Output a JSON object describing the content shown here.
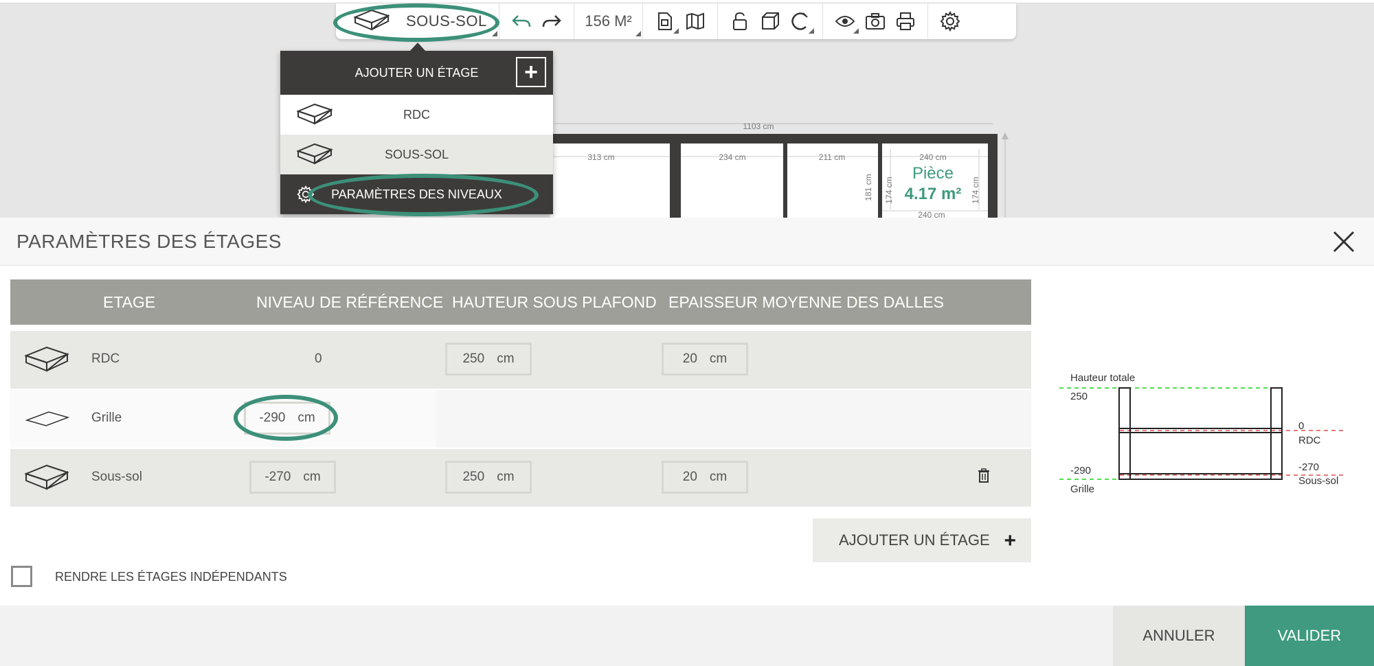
{
  "toolbar": {
    "current_floor": "SOUS-SOL",
    "area": "156 M²"
  },
  "floor_menu": {
    "add_label": "AJOUTER UN ÉTAGE",
    "add_icon": "plus-icon",
    "items": [
      {
        "label": "RDC"
      },
      {
        "label": "SOUS-SOL"
      }
    ],
    "settings_label": "PARAMÈTRES DES NIVEAUX"
  },
  "plan": {
    "total_width": "1103 cm",
    "dims": [
      "313 cm",
      "234 cm",
      "211 cm",
      "240 cm",
      "240 cm",
      "181 cm",
      "174 cm",
      "174 cm"
    ],
    "room_name": "Pièce",
    "room_area": "4.17 m²"
  },
  "modal": {
    "title": "PARAMÈTRES DES ÉTAGES",
    "columns": [
      "ETAGE",
      "NIVEAU DE RÉFÉRENCE",
      "HAUTEUR SOUS PLAFOND",
      "EPAISSEUR MOYENNE DES DALLES"
    ],
    "rows": [
      {
        "name": "RDC",
        "reference": "0",
        "height": "250",
        "height_unit": "cm",
        "slab": "20",
        "slab_unit": "cm"
      },
      {
        "name": "Grille",
        "reference": "-290",
        "reference_unit": "cm"
      },
      {
        "name": "Sous-sol",
        "reference": "-270",
        "reference_unit": "cm",
        "height": "250",
        "height_unit": "cm",
        "slab": "20",
        "slab_unit": "cm"
      }
    ],
    "add_floor": "AJOUTER UN ÉTAGE",
    "independent_label": "RENDRE LES ÉTAGES INDÉPENDANTS",
    "independent_checked": false,
    "cancel": "ANNULER",
    "validate": "VALIDER"
  },
  "diagram": {
    "total_label": "Hauteur totale",
    "top_value": "250",
    "rdc_value": "0",
    "rdc_label": "RDC",
    "grille_value": "-290",
    "grille_label": "Grille",
    "soussol_value": "-270",
    "soussol_label": "Sous-sol"
  },
  "colors": {
    "accent": "#3f9a7f",
    "header_grey": "#9f9f99",
    "menu_dark": "#3d3b39"
  }
}
